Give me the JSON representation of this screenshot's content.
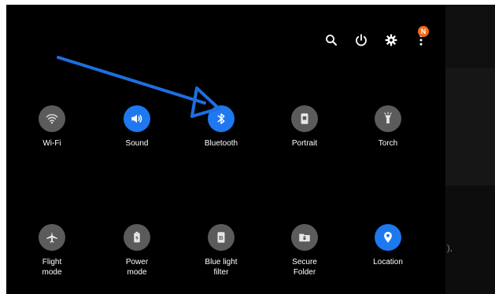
{
  "top_bar": {
    "icons": [
      "search-icon",
      "power-icon",
      "settings-icon",
      "more-options-icon"
    ],
    "badge_letter": "N",
    "badge_color": "#f26a1b"
  },
  "tiles_row1": [
    {
      "label": "Wi-Fi",
      "icon": "wifi-icon",
      "active": false
    },
    {
      "label": "Sound",
      "icon": "sound-icon",
      "active": true
    },
    {
      "label": "Bluetooth",
      "icon": "bluetooth-icon",
      "active": true
    },
    {
      "label": "Portrait",
      "icon": "portrait-icon",
      "active": false
    },
    {
      "label": "Torch",
      "icon": "torch-icon",
      "active": false
    }
  ],
  "tiles_row2": [
    {
      "label": "Flight\nmode",
      "icon": "airplane-icon",
      "active": false
    },
    {
      "label": "Power\nmode",
      "icon": "battery-icon",
      "active": false
    },
    {
      "label": "Blue light\nfilter",
      "icon": "blue-light-icon",
      "active": false
    },
    {
      "label": "Secure\nFolder",
      "icon": "secure-folder-icon",
      "active": false
    },
    {
      "label": "Location",
      "icon": "location-icon",
      "active": true
    }
  ],
  "right_strip": {
    "mark": "),"
  },
  "colors": {
    "panel_background": "#000000",
    "active_tile": "#1e78f0",
    "inactive_tile": "#5b5b5b",
    "annotation_arrow": "#1e6fe0"
  }
}
